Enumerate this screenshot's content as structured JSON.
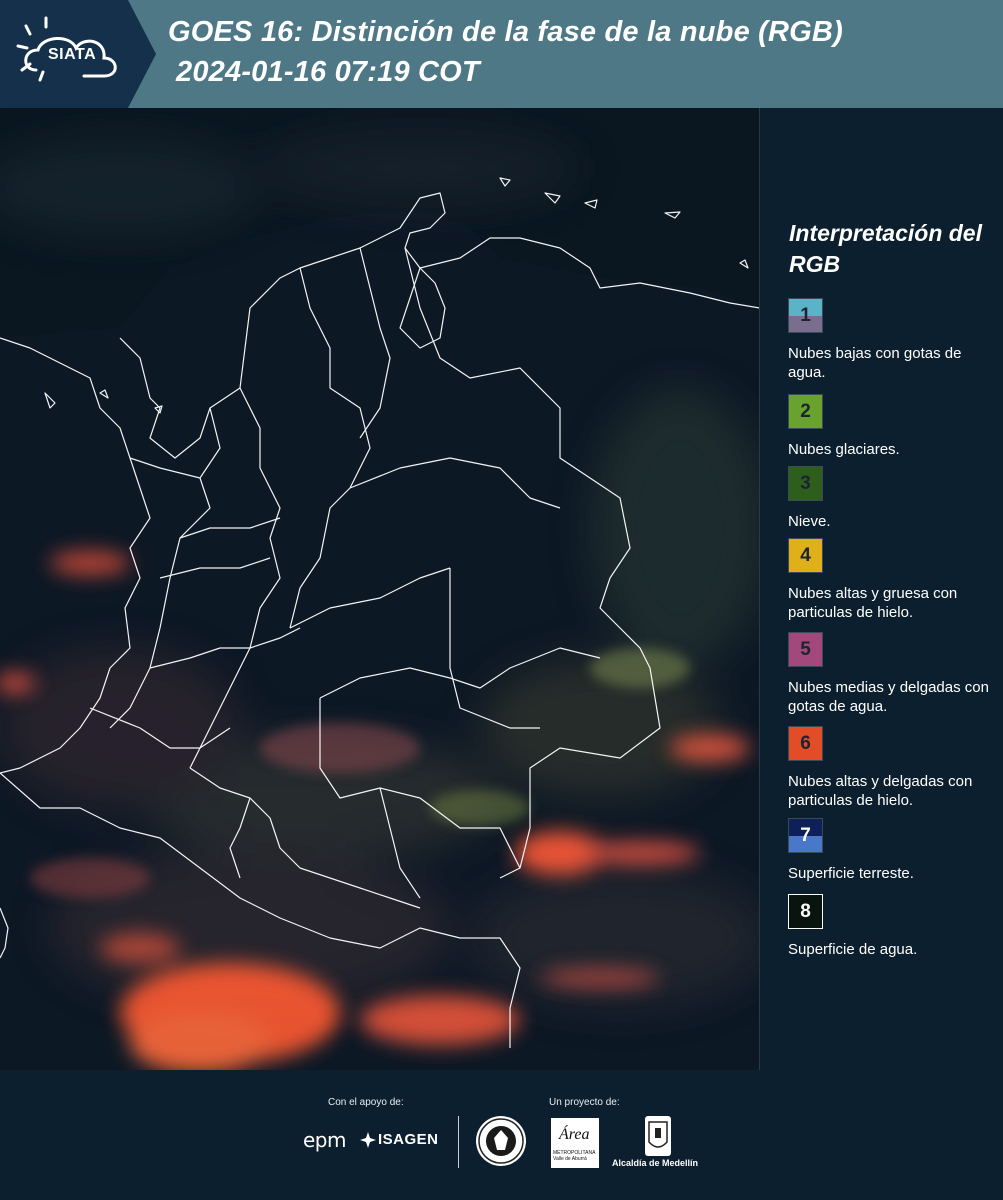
{
  "header": {
    "logo_text": "SIATA",
    "title_line1": "GOES 16: Distinción de la fase de la nube (RGB)",
    "title_line2": "2024-01-16 07:19 COT"
  },
  "legend": {
    "title": "Interpretación del RGB",
    "items": [
      {
        "number": "1",
        "colors": [
          "#5bb3c7",
          "#7a6d8e"
        ],
        "text": "Nubes bajas con gotas de agua."
      },
      {
        "number": "2",
        "colors": [
          "#6aa22e"
        ],
        "text": "Nubes glaciares."
      },
      {
        "number": "3",
        "colors": [
          "#2e5e1c"
        ],
        "text": "Nieve."
      },
      {
        "number": "4",
        "colors": [
          "#e0b01a"
        ],
        "text": "Nubes altas y gruesa con particulas de hielo."
      },
      {
        "number": "5",
        "colors": [
          "#a3487c"
        ],
        "text": "Nubes medias y delgadas con gotas de agua."
      },
      {
        "number": "6",
        "colors": [
          "#e24d27"
        ],
        "text": "Nubes altas y delgadas con particulas de hielo."
      },
      {
        "number": "7",
        "colors": [
          "#0e1f5a",
          "#4a78c8"
        ],
        "text": "Superficie terreste."
      },
      {
        "number": "8",
        "colors": [
          "#0a140f"
        ],
        "text": "Superficie de agua."
      }
    ]
  },
  "footer": {
    "support_label": "Con el apoyo de:",
    "project_label": "Un proyecto de:",
    "sponsor_1": "epm",
    "sponsor_2": "ISAGEN",
    "area_logo_word": "Área",
    "area_logo_sub": "METROPOLITANA Valle de Aburrá",
    "alcaldia": "Alcaldía de Medellín"
  },
  "colors": {
    "header_bg": "#4f7886",
    "logo_bg": "#14304a",
    "panel_bg": "#0c1f2e",
    "map_bg": "#0a1620",
    "border_lines": "#ffffff",
    "cloud_red": "#ff5a32"
  }
}
